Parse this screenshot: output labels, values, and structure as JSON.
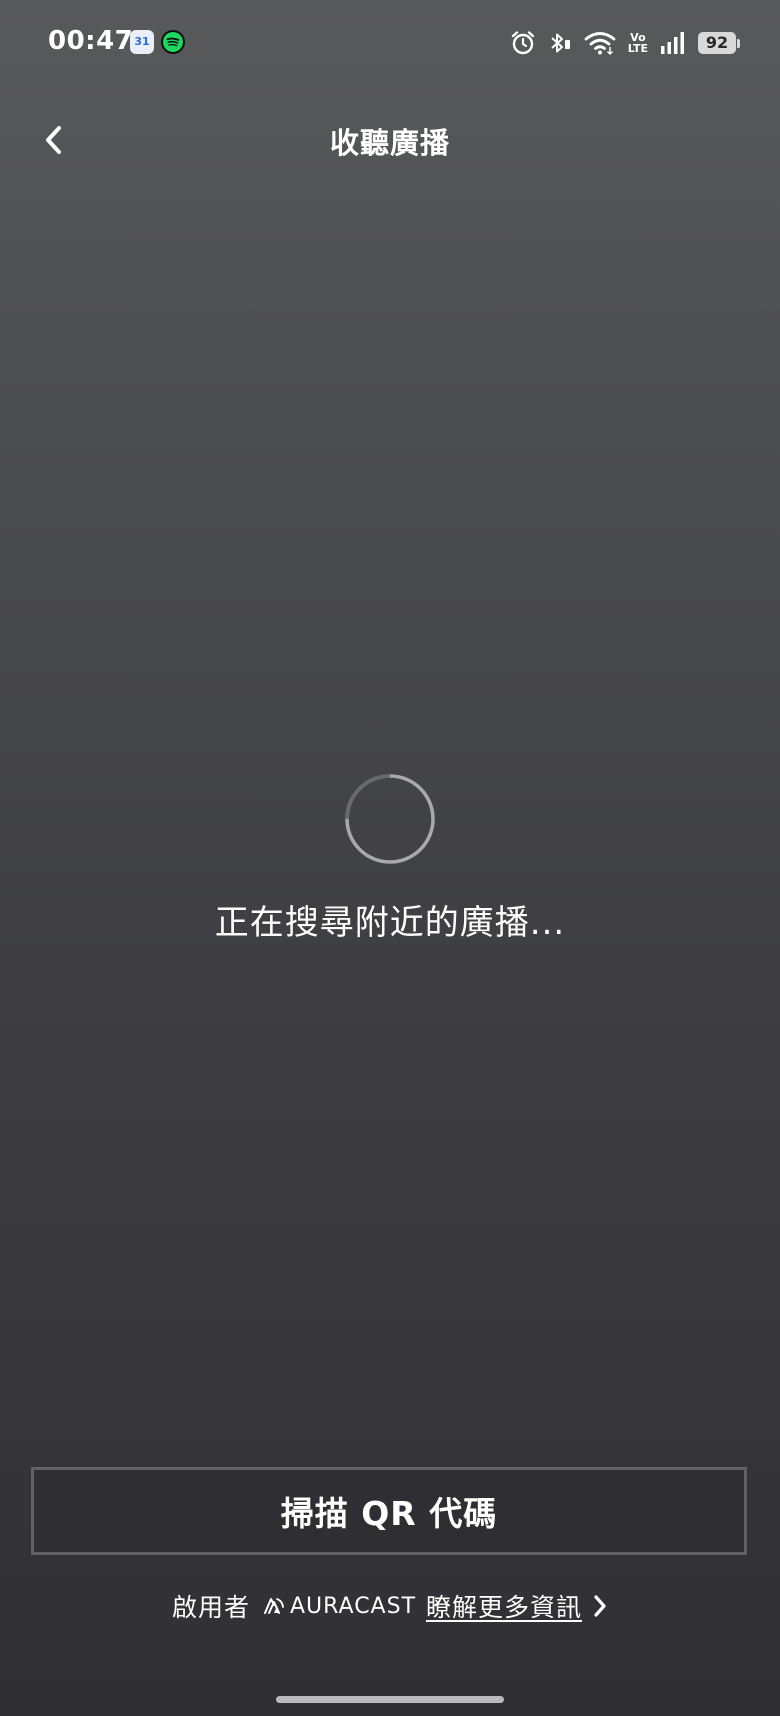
{
  "status_bar": {
    "time": "00:47",
    "calendar_day": "31",
    "network_label": "Vo",
    "network_sub_label": "LTE",
    "battery": "92",
    "icons": [
      "calendar-icon",
      "spotify-icon",
      "alarm-icon",
      "bluetooth-icon",
      "wifi-icon",
      "signal-icon",
      "battery-icon"
    ]
  },
  "header": {
    "title": "收聽廣播",
    "back_icon": "chevron-left-icon"
  },
  "main": {
    "spinner_icon": "loading-spinner-icon",
    "searching_text": "正在搜尋附近的廣播..."
  },
  "scan_button": {
    "label": "掃描 QR 代碼"
  },
  "footer": {
    "enabled_by": "啟用者",
    "brand": "AURACAST",
    "learn_more": "瞭解更多資訊",
    "chevron_icon": "chevron-right-icon"
  },
  "colors": {
    "background_top": "#58595b",
    "background_bottom": "#303034",
    "button_border": "#606065",
    "text": "#ffffff"
  }
}
